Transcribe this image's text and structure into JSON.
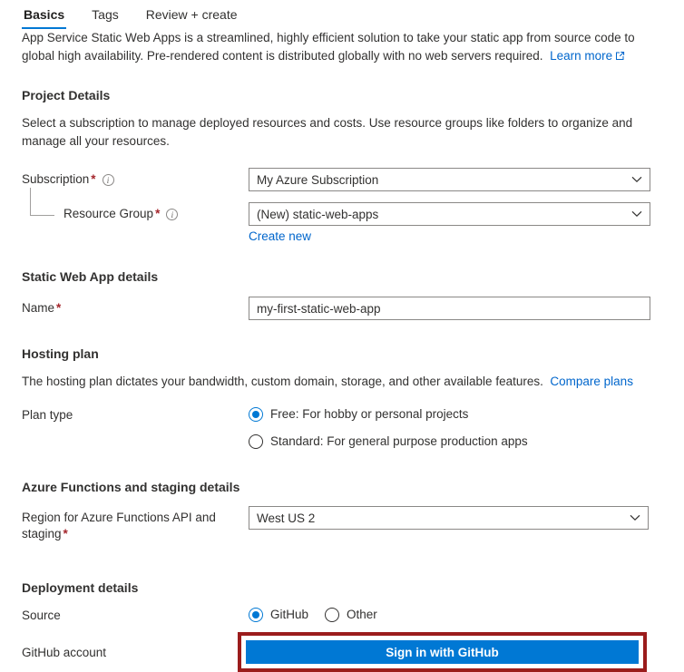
{
  "tabs": [
    {
      "label": "Basics",
      "active": true
    },
    {
      "label": "Tags",
      "active": false
    },
    {
      "label": "Review + create",
      "active": false
    }
  ],
  "intro": {
    "text": "App Service Static Web Apps is a streamlined, highly efficient solution to take your static app from source code to global high availability. Pre-rendered content is distributed globally with no web servers required.",
    "learn_more": "Learn more"
  },
  "project_details": {
    "heading": "Project Details",
    "description": "Select a subscription to manage deployed resources and costs. Use resource groups like folders to organize and manage all your resources.",
    "subscription": {
      "label": "Subscription",
      "value": "My Azure Subscription",
      "required": "*"
    },
    "resource_group": {
      "label": "Resource Group",
      "value": "(New) static-web-apps",
      "required": "*",
      "create_new": "Create new"
    }
  },
  "app_details": {
    "heading": "Static Web App details",
    "name": {
      "label": "Name",
      "value": "my-first-static-web-app",
      "required": "*"
    }
  },
  "hosting_plan": {
    "heading": "Hosting plan",
    "description": "The hosting plan dictates your bandwidth, custom domain, storage, and other available features.",
    "compare_link": "Compare plans",
    "plan_type_label": "Plan type",
    "options": [
      {
        "label": "Free: For hobby or personal projects",
        "selected": true
      },
      {
        "label": "Standard: For general purpose production apps",
        "selected": false
      }
    ]
  },
  "functions": {
    "heading": "Azure Functions and staging details",
    "region": {
      "label": "Region for Azure Functions API and staging",
      "value": "West US 2",
      "required": "*"
    }
  },
  "deployment": {
    "heading": "Deployment details",
    "source_label": "Source",
    "source_options": [
      {
        "label": "GitHub",
        "selected": true
      },
      {
        "label": "Other",
        "selected": false
      }
    ],
    "github_account_label": "GitHub account",
    "sign_in_button": "Sign in with GitHub"
  },
  "colors": {
    "accent": "#0078d4",
    "link": "#0066cc",
    "required": "#a4262c",
    "highlight": "#9b1c1c",
    "border": "#8a8886"
  }
}
